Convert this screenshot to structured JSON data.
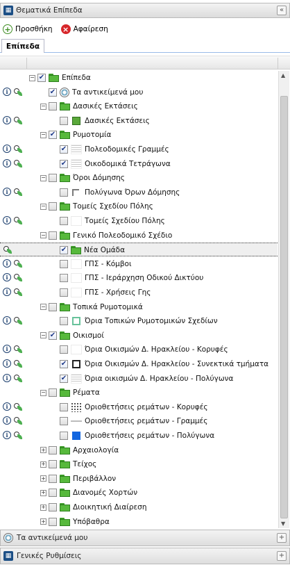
{
  "header": {
    "title": "Θεματικά Επίπεδα",
    "collapse": "«"
  },
  "toolbar": {
    "add_label": "Προσθήκη",
    "remove_label": "Αφαίρεση"
  },
  "tabs": {
    "active": "Επίπεδα"
  },
  "tree": [
    {
      "label": "Επίπεδα",
      "depth": 0,
      "expander": "−",
      "checked": true,
      "icon": "folder",
      "actions": false
    },
    {
      "label": "Τα αντικείμενά μου",
      "depth": 1,
      "expander": "",
      "checked": true,
      "icon": "gear",
      "actions": true
    },
    {
      "label": "Δασικές Εκτάσεις",
      "depth": 1,
      "expander": "−",
      "checked": false,
      "icon": "folder",
      "actions": false
    },
    {
      "label": "Δασικές Εκτάσεις",
      "depth": 2,
      "expander": "",
      "checked": false,
      "icon": "sq-green",
      "actions": true
    },
    {
      "label": "Ρυμοτομία",
      "depth": 1,
      "expander": "−",
      "checked": true,
      "icon": "folder",
      "actions": false
    },
    {
      "label": "Πολεοδομικές Γραμμές",
      "depth": 2,
      "expander": "",
      "checked": true,
      "icon": "lines",
      "actions": true
    },
    {
      "label": "Οικοδομικά Τετράγωνα",
      "depth": 2,
      "expander": "",
      "checked": true,
      "icon": "lines",
      "actions": true
    },
    {
      "label": "Όροι Δόμησης",
      "depth": 1,
      "expander": "−",
      "checked": false,
      "icon": "folder",
      "actions": false
    },
    {
      "label": "Πολύγωνα Όρων Δόμησης",
      "depth": 2,
      "expander": "",
      "checked": false,
      "icon": "poly",
      "actions": true
    },
    {
      "label": "Τομείς Σχεδίου Πόλης",
      "depth": 1,
      "expander": "−",
      "checked": false,
      "icon": "folder",
      "actions": false
    },
    {
      "label": "Τομείς Σχεδίου Πόλης",
      "depth": 2,
      "expander": "",
      "checked": false,
      "icon": "blank",
      "actions": true
    },
    {
      "label": "Γενικό Πολεοδομικό Σχέδιο",
      "depth": 1,
      "expander": "−",
      "checked": false,
      "icon": "folder",
      "actions": false
    },
    {
      "label": "Νέα Ομάδα",
      "depth": 2,
      "expander": "",
      "checked": true,
      "icon": "folder",
      "actions": "zoom-only",
      "selected": true
    },
    {
      "label": "ΓΠΣ - Κόμβοι",
      "depth": 2,
      "expander": "",
      "checked": false,
      "icon": "blank",
      "actions": true
    },
    {
      "label": "ΓΠΣ - Ιεράρχηση Οδικού Δικτύου",
      "depth": 2,
      "expander": "",
      "checked": false,
      "icon": "blank",
      "actions": true
    },
    {
      "label": "ΓΠΣ - Χρήσεις Γης",
      "depth": 2,
      "expander": "",
      "checked": false,
      "icon": "blank",
      "actions": true
    },
    {
      "label": "Τοπικά Ρυμοτομικά",
      "depth": 1,
      "expander": "−",
      "checked": false,
      "icon": "folder",
      "actions": false
    },
    {
      "label": "Όρια Τοπικών Ρυμοτομικών Σχεδίων",
      "depth": 2,
      "expander": "",
      "checked": false,
      "icon": "sq-outline",
      "actions": true
    },
    {
      "label": "Οικισμοί",
      "depth": 1,
      "expander": "−",
      "checked": true,
      "icon": "folder",
      "actions": false
    },
    {
      "label": "Όρια Οικισμών Δ. Ηρακλείου - Κορυφές",
      "depth": 2,
      "expander": "",
      "checked": false,
      "icon": "blank",
      "actions": true
    },
    {
      "label": "Όρια Οικισμών Δ. Ηρακλείου - Συνεκτικά τμήματα",
      "depth": 2,
      "expander": "",
      "checked": true,
      "icon": "dash",
      "actions": true
    },
    {
      "label": "Όρια οικισμών Δ. Ηρακλείου - Πολύγωνα",
      "depth": 2,
      "expander": "",
      "checked": true,
      "icon": "lines",
      "actions": true
    },
    {
      "label": "Ρέματα",
      "depth": 1,
      "expander": "−",
      "checked": false,
      "icon": "folder",
      "actions": false
    },
    {
      "label": "Οριοθετήσεις ρεμάτων - Κορυφές",
      "depth": 2,
      "expander": "",
      "checked": false,
      "icon": "dots",
      "actions": true
    },
    {
      "label": "Οριοθετήσεις ρεμάτων - Γραμμές",
      "depth": 2,
      "expander": "",
      "checked": false,
      "icon": "wave",
      "actions": true
    },
    {
      "label": "Οριοθετήσεις ρεμάτων - Πολύγωνα",
      "depth": 2,
      "expander": "",
      "checked": false,
      "icon": "sq-blue",
      "actions": true
    },
    {
      "label": "Αρχαιολογία",
      "depth": 1,
      "expander": "+",
      "checked": false,
      "icon": "folder",
      "actions": false
    },
    {
      "label": "Τείχος",
      "depth": 1,
      "expander": "+",
      "checked": false,
      "icon": "folder",
      "actions": false
    },
    {
      "label": "Περιβάλλον",
      "depth": 1,
      "expander": "+",
      "checked": false,
      "icon": "folder",
      "actions": false
    },
    {
      "label": "Διανομές Χορτών",
      "depth": 1,
      "expander": "+",
      "checked": false,
      "icon": "folder",
      "actions": false
    },
    {
      "label": "Διοικητική Διαίρεση",
      "depth": 1,
      "expander": "+",
      "checked": false,
      "icon": "folder",
      "actions": false
    },
    {
      "label": "Υπόβαθρα",
      "depth": 1,
      "expander": "+",
      "checked": false,
      "icon": "folder",
      "actions": false
    }
  ],
  "footer": {
    "my_objects": "Τα αντικείμενά μου",
    "general_settings": "Γενικές Ρυθμίσεις",
    "expand": "+"
  }
}
